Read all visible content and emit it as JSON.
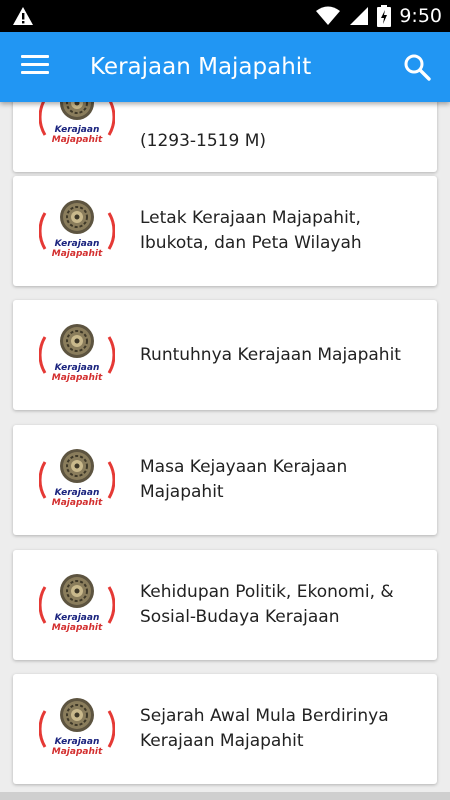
{
  "status_bar": {
    "time": "9:50"
  },
  "app_bar": {
    "title": "Kerajaan Majapahit"
  },
  "logo_text": {
    "line1": "Kerajaan",
    "line2": "Majapahit"
  },
  "items": [
    {
      "label": "(1293-1519 M)"
    },
    {
      "label": "Letak Kerajaan Majapahit, Ibukota, dan Peta Wilayah"
    },
    {
      "label": "Runtuhnya Kerajaan Majapahit"
    },
    {
      "label": "Masa Kejayaan Kerajaan Majapahit"
    },
    {
      "label": "Kehidupan Politik, Ekonomi, & Sosial-Budaya Kerajaan"
    },
    {
      "label": "Sejarah Awal Mula Berdirinya Kerajaan Majapahit"
    }
  ],
  "colors": {
    "app_bar": "#2196F3",
    "logo_ring": "#e53935",
    "logo_text_blue": "#1a237e",
    "logo_text_red": "#d32f2f"
  },
  "icons": {
    "menu": "hamburger-menu-icon",
    "search": "search-icon",
    "warning": "warning-icon",
    "wifi": "wifi-icon",
    "signal": "cell-signal-icon",
    "battery": "battery-charging-icon"
  }
}
